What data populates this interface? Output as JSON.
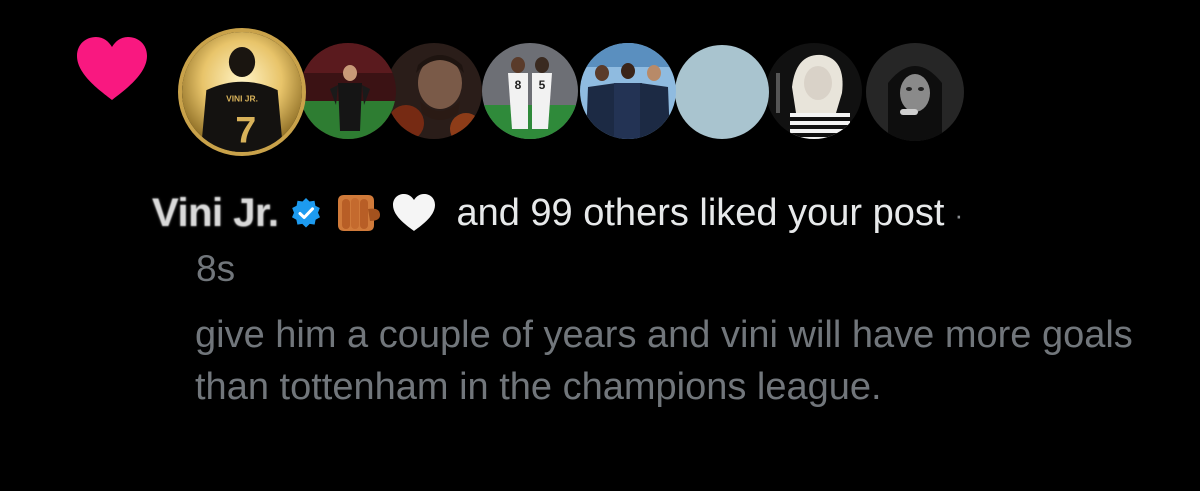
{
  "notification": {
    "type_icon": "heart-icon",
    "accent_color": "#f91880",
    "avatars": [
      {
        "name": "avatar-jersey-7",
        "jersey_text": "VINI JR.",
        "jersey_number": "7"
      },
      {
        "name": "avatar-coach-pitch"
      },
      {
        "name": "avatar-portrait-fire"
      },
      {
        "name": "avatar-players-numbers",
        "numbers": [
          "8",
          "5"
        ]
      },
      {
        "name": "avatar-team-group"
      },
      {
        "name": "avatar-blank"
      },
      {
        "name": "avatar-blonde-striped"
      },
      {
        "name": "avatar-dark-portrait"
      }
    ],
    "user": {
      "name": "Vini Jr.",
      "verified": true,
      "verified_color": "#1d9bf0",
      "emojis": [
        "fist-icon",
        "white-heart-icon"
      ]
    },
    "liked_text": "and 99 others liked your post",
    "separator": "·",
    "timestamp": "8s",
    "post_text": "give him a couple of years and vini will have more goals than tottenham in the champions league."
  }
}
